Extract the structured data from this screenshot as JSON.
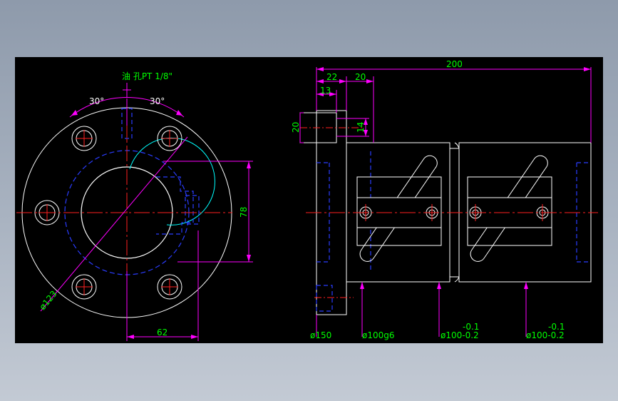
{
  "colors": {
    "outline": "#ffffff",
    "center_line": "#ff2020",
    "hidden_line": "#2a3cff",
    "dimension_line": "#ff00ff",
    "dimension_text": "#00ff00",
    "thread_circle": "#00ffff",
    "background": "#000000"
  },
  "front_view": {
    "oil_hole_label": "油 孔PT 1/8\"",
    "angle_left": "30°",
    "angle_right": "30°",
    "dim_height": "78",
    "dim_width": "62",
    "dim_pcd": "ø123"
  },
  "side_view": {
    "dim_total_length": "200",
    "dim_22": "22",
    "dim_20_top": "20",
    "dim_13": "13",
    "dim_20_left": "20",
    "dim_14": "14",
    "dia_flange": "ø150",
    "dia_body": "ø100g6",
    "dia_nut1": "ø100-0.2",
    "tol_nut1": "-0.1",
    "dia_nut2": "ø100-0.2",
    "tol_nut2": "-0.1"
  }
}
